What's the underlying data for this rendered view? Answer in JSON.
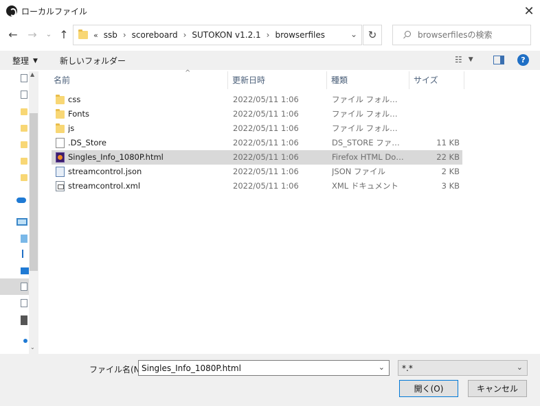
{
  "window": {
    "title": "ローカルファイル",
    "close_glyph": "✕"
  },
  "nav": {
    "back_glyph": "←",
    "forward_glyph": "→",
    "recent_glyph": "⌄",
    "up_glyph": "↑",
    "refresh_glyph": "↻",
    "breadcrumb_overflow": "«",
    "breadcrumbs": [
      "ssb",
      "scoreboard",
      "SUTOKON v1.2.1",
      "browserfiles"
    ],
    "separator": "›",
    "address_dropdown_glyph": "⌄",
    "search_placeholder": "browserfilesの検索"
  },
  "toolbar": {
    "organize_label": "整理",
    "organize_caret": "▼",
    "new_folder_label": "新しいフォルダー",
    "view_glyph": "☷",
    "view_caret": "▼",
    "help_glyph": "?"
  },
  "columns": {
    "name": "名前",
    "date": "更新日時",
    "type": "種類",
    "size": "サイズ",
    "sort_glyph": "^"
  },
  "files": [
    {
      "name": "css",
      "date": "2022/05/11 1:06",
      "type": "ファイル フォルダー",
      "size": "",
      "icon": "folder-icon"
    },
    {
      "name": "Fonts",
      "date": "2022/05/11 1:06",
      "type": "ファイル フォルダー",
      "size": "",
      "icon": "folder-icon"
    },
    {
      "name": "js",
      "date": "2022/05/11 1:06",
      "type": "ファイル フォルダー",
      "size": "",
      "icon": "folder-icon"
    },
    {
      "name": ".DS_Store",
      "date": "2022/05/11 1:06",
      "type": "DS_STORE ファイル",
      "size": "11 KB",
      "icon": "file-icon"
    },
    {
      "name": "Singles_Info_1080P.html",
      "date": "2022/05/11 1:06",
      "type": "Firefox HTML Doc...",
      "size": "22 KB",
      "icon": "firefox-html-icon",
      "selected": true
    },
    {
      "name": "streamcontrol.json",
      "date": "2022/05/11 1:06",
      "type": "JSON ファイル",
      "size": "2 KB",
      "icon": "json-file-icon"
    },
    {
      "name": "streamcontrol.xml",
      "date": "2022/05/11 1:06",
      "type": "XML ドキュメント",
      "size": "3 KB",
      "icon": "xml-file-icon"
    }
  ],
  "footer": {
    "filename_label": "ファイル名(N):",
    "filename_value": "Singles_Info_1080P.html",
    "filter_value": "*.*",
    "dropdown_glyph": "⌄",
    "open_label": "開く(O)",
    "cancel_label": "キャンセル"
  },
  "scrollbar": {
    "up_glyph": "▲",
    "down_glyph": "⌄"
  }
}
